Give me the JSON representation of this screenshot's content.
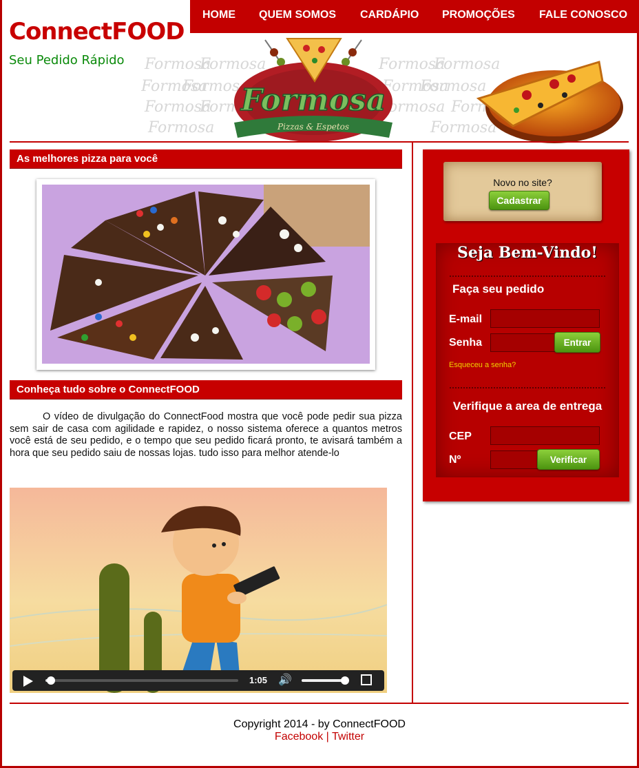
{
  "nav": {
    "items": [
      "HOME",
      "QUEM SOMOS",
      "CARDÁPIO",
      "PROMOÇÕES",
      "FALE CONOSCO"
    ]
  },
  "brand": {
    "logo": "ConnectFOOD",
    "slogan": "Seu Pedido Rápido",
    "banner_word": "Formosa",
    "banner_sub": "Pizzas & Espetos"
  },
  "main": {
    "section1_title": "As melhores pizza para você",
    "section2_title": "Conheça tudo sobre o ConnectFOOD",
    "paragraph": "O vídeo de divulgação do ConnectFood mostra que você pode pedir sua pizza sem sair de casa com agilidade e rapidez, o nosso sistema oferece a quantos metros você está de seu pedido, e o tempo que seu pedido ficará pronto, te avisará também a hora que seu pedido saiu de nossas lojas. tudo isso para melhor atende-lo",
    "video": {
      "time": "1:05",
      "progress": 0.03,
      "volume": 0.95
    }
  },
  "sidebar": {
    "new_prompt": "Novo no site?",
    "register_label": "Cadastrar",
    "welcome": "Seja Bem-Vindo!",
    "order_heading": "Faça seu pedido",
    "email_label": "E-mail",
    "password_label": "Senha",
    "login_label": "Entrar",
    "forgot_label": "Esqueceu a senha?",
    "delivery_heading": "Verifique a area de entrega",
    "cep_label": "CEP",
    "number_label": "Nº",
    "verify_label": "Verificar"
  },
  "footer": {
    "copyright": "Copyright 2014 - by ConnectFOOD",
    "facebook": "Facebook",
    "separator": "|",
    "twitter": "Twitter"
  },
  "colors": {
    "brand_red": "#c30000",
    "brand_green": "#0a8a0a",
    "button_green": "#5fa81c"
  }
}
